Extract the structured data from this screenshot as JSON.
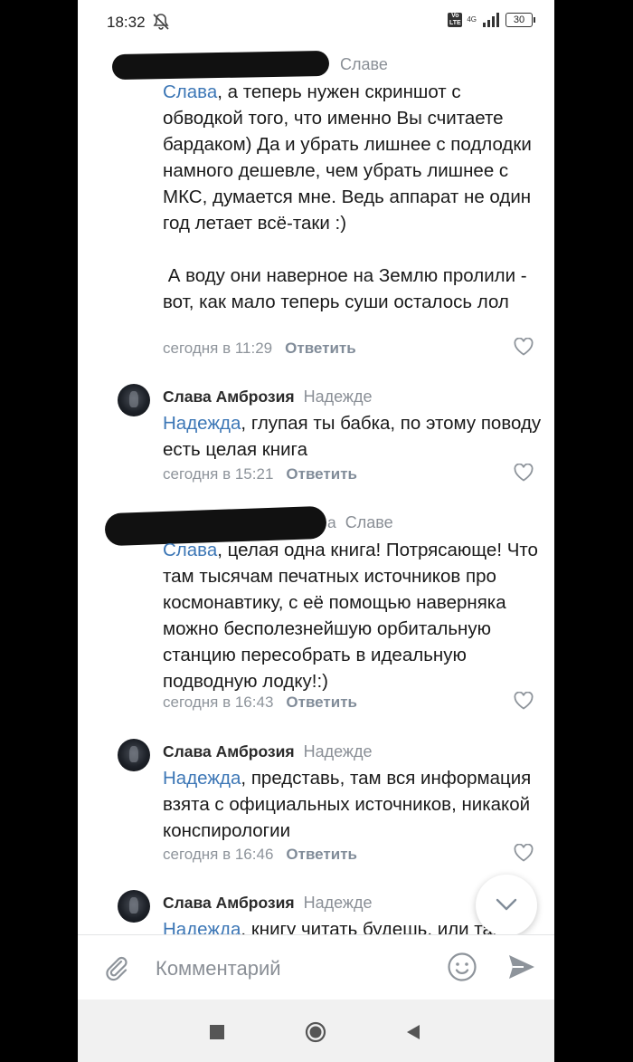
{
  "status_bar": {
    "time": "18:32",
    "network": "4G",
    "volte": "Vo LTE",
    "battery": "30"
  },
  "comments": [
    {
      "author": "",
      "reply_to": "Славе",
      "mention": "Слава",
      "text": ", а теперь нужен скриншот с обводкой того, что именно Вы считаете бардаком) Да и убрать лишнее с подлодки намного дешевле, чем убрать лишнее с МКС, думается мне. Ведь аппарат не один год летает всё-таки :)\n\n А воду они наверное на Землю пролили - вот, как мало теперь суши осталось лол",
      "time": "сегодня в 11:29",
      "reply_label": "Ответить"
    },
    {
      "author": "Слава Амброзия",
      "reply_to": "Надежде",
      "mention": "Надежда",
      "text": ", глупая ты бабка, по этому поводу есть целая книга",
      "time": "сегодня в 15:21",
      "reply_label": "Ответить"
    },
    {
      "author": "",
      "reply_to_prefix": "а",
      "reply_to": "Славе",
      "mention": "Слава",
      "text": ", целая одна книга! Потрясающе! Что там тысячам печатных источников про космонавтику, с её помощью наверняка можно бесполезнейшую орбитальную станцию пересобрать в идеальную подводную лодку!:)",
      "time": "сегодня в 16:43",
      "reply_label": "Ответить"
    },
    {
      "author": "Слава Амброзия",
      "reply_to": "Надежде",
      "mention": "Надежда",
      "text": ", представь, там вся информация взята с официальных источников, никакой конспирологии",
      "time": "сегодня в 16:46",
      "reply_label": "Ответить"
    },
    {
      "author": "Слава Амброзия",
      "reply_to": "Надежде",
      "mention": "Надежда",
      "text": ", книгу читать будешь, или так"
    }
  ],
  "composer": {
    "placeholder": "Комментарий"
  },
  "colors": {
    "mention": "#3d77b6",
    "meta": "#8e949b",
    "text": "#1a1a1a"
  },
  "icons": [
    "mute-icon",
    "signal-icon",
    "battery-icon",
    "like-icon",
    "chevron-down-icon",
    "attach-icon",
    "emoji-icon",
    "send-icon",
    "nav-recents-icon",
    "nav-home-icon",
    "nav-back-icon"
  ]
}
